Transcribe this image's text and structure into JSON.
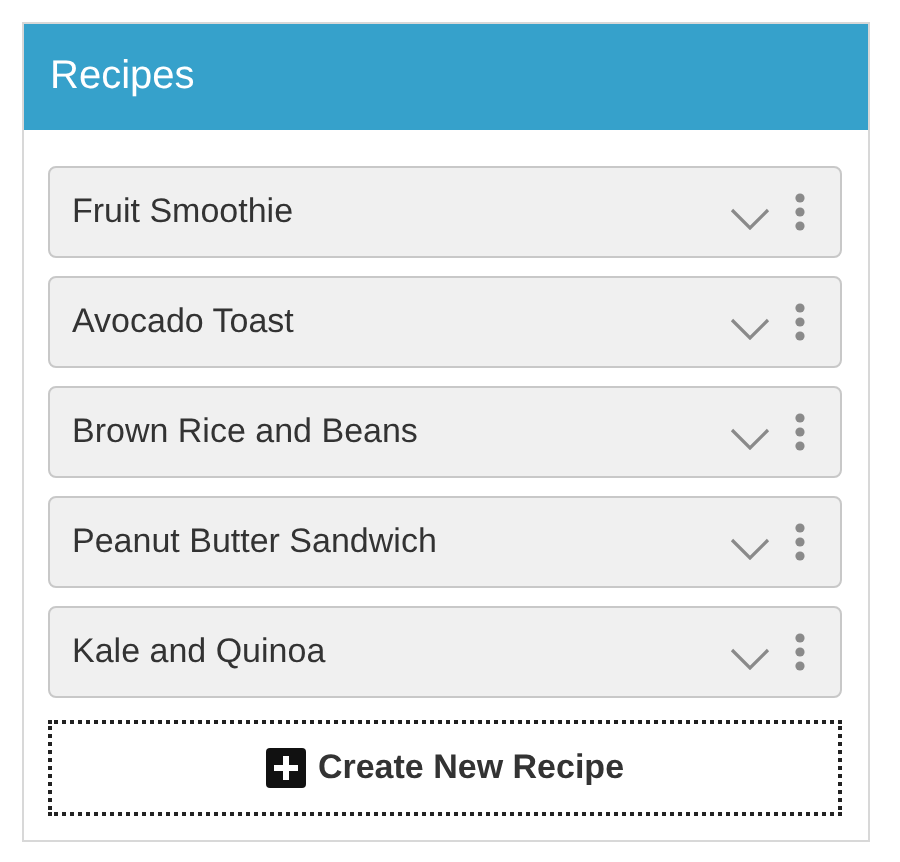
{
  "panel": {
    "title": "Recipes"
  },
  "recipes": [
    {
      "name": "Fruit Smoothie"
    },
    {
      "name": "Avocado Toast"
    },
    {
      "name": "Brown Rice and Beans"
    },
    {
      "name": "Peanut Butter Sandwich"
    },
    {
      "name": "Kale and Quinoa"
    }
  ],
  "create_button": {
    "label": "Create New Recipe"
  }
}
